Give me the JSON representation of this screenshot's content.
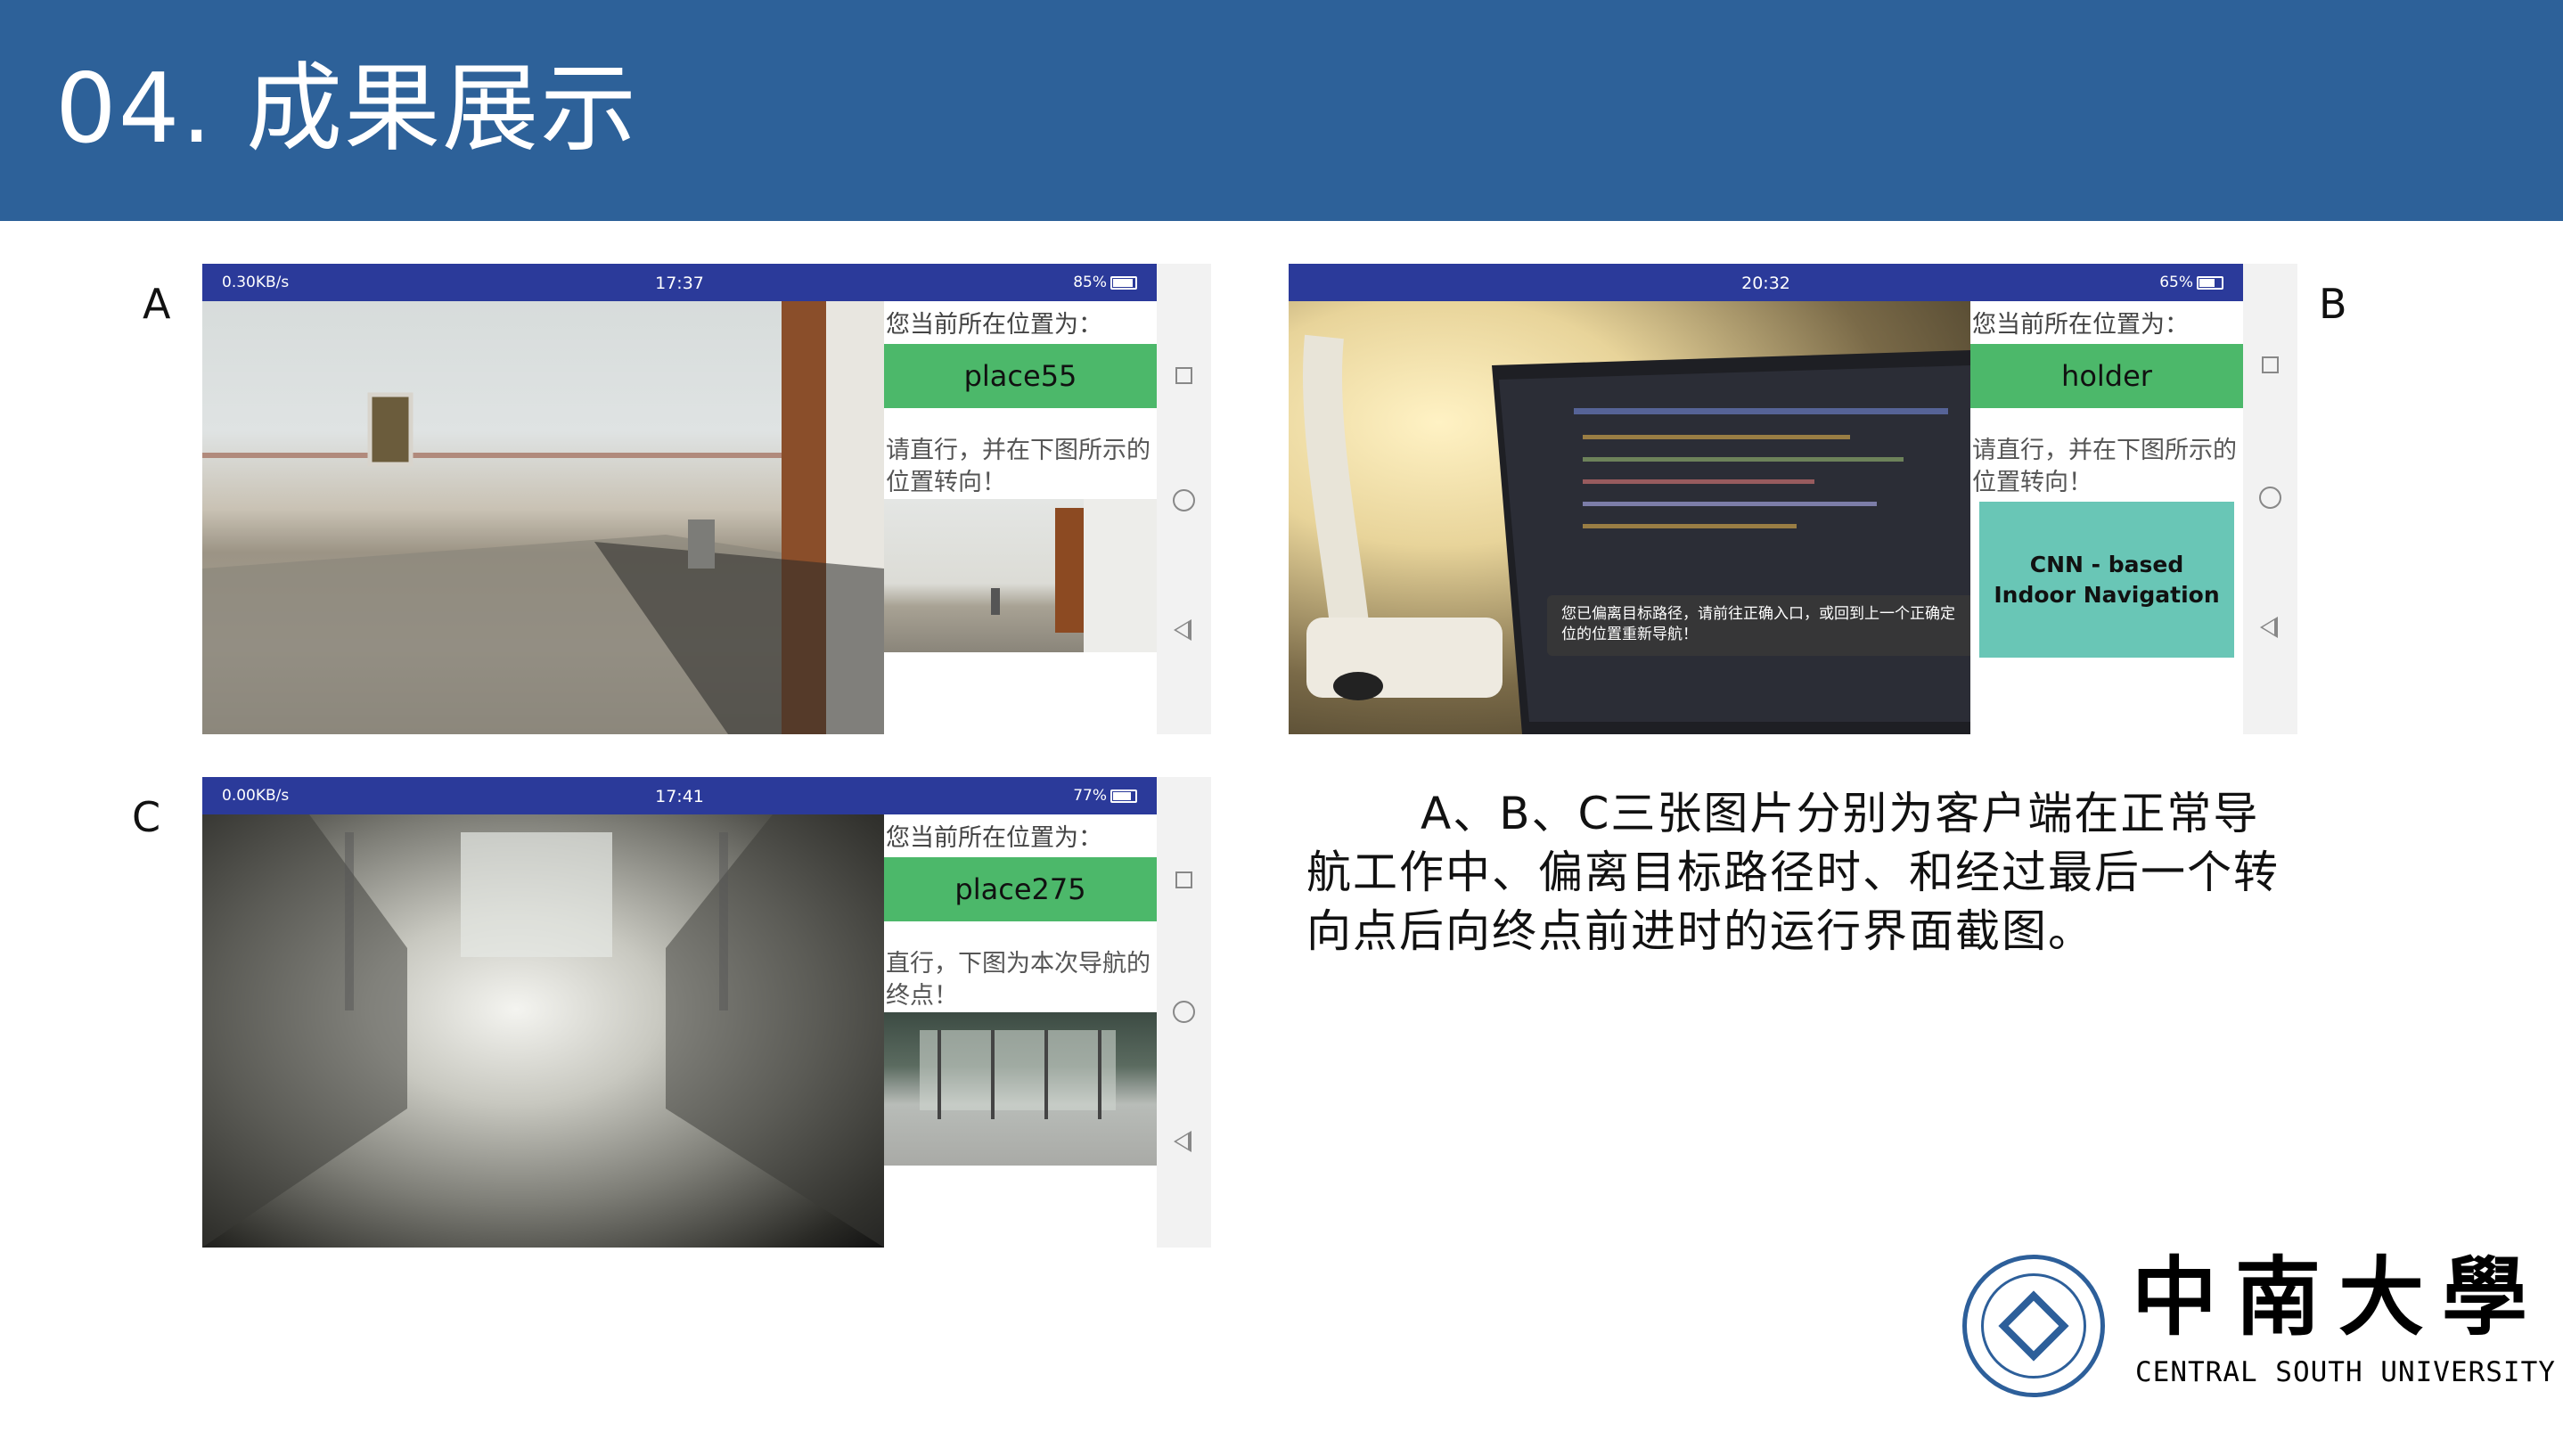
{
  "slide": {
    "title": "04. 成果展示"
  },
  "labels": {
    "a": "A",
    "b": "B",
    "c": "C"
  },
  "screen_a": {
    "status": {
      "left": "0.30KB/s",
      "time": "17:37",
      "battery": "85%"
    },
    "position_label": "您当前所在位置为：",
    "place": "place55",
    "instruction": "请直行，并在下图所示的位置转向！"
  },
  "screen_b": {
    "status": {
      "time": "20:32",
      "battery": "65%"
    },
    "position_label": "您当前所在位置为：",
    "place": "holder",
    "instruction": "请直行，并在下图所示的位置转向！",
    "cnn_line1": "CNN - based",
    "cnn_line2": "Indoor Navigation",
    "toast": "您已偏离目标路径，请前往正确入口，或回到上一个正确定位的位置重新导航！"
  },
  "screen_c": {
    "status": {
      "left": "0.00KB/s",
      "time": "17:41",
      "battery": "77%"
    },
    "position_label": "您当前所在位置为：",
    "place": "place275",
    "instruction": "直行，下图为本次导航的终点！"
  },
  "description": "A、B、C三张图片分别为客户端在正常导航工作中、偏离目标路径时、和经过最后一个转向点后向终点前进时的运行界面截图。",
  "logo": {
    "cn": "中南大學",
    "en": "CENTRAL SOUTH UNIVERSITY"
  },
  "colors": {
    "header": "#2d6199",
    "status_bar": "#2b3a9a",
    "place_box": "#4cb86a",
    "cnn_box": "#69c6b6"
  }
}
